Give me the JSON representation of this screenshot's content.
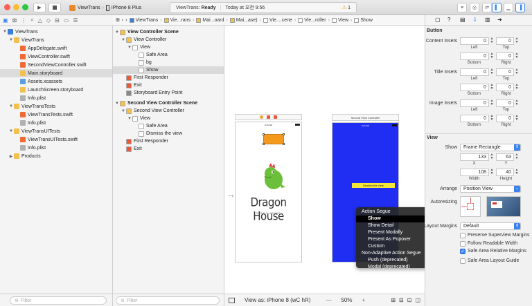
{
  "toolbar": {
    "scheme_app": "ViewTrans",
    "scheme_device": "iPhone 8 Plus",
    "status_app": "ViewTrans:",
    "status_state": "Ready",
    "status_time": "Today at 오전 9:56",
    "warning_count": "1"
  },
  "navigator": {
    "rows": [
      {
        "label": "ViewTrans",
        "indent": 0,
        "disc": "▼",
        "icon": "project-icon",
        "color": "#3b7fd9"
      },
      {
        "label": "ViewTrans",
        "indent": 1,
        "disc": "▼",
        "icon": "folder-icon",
        "color": "#f2c04e"
      },
      {
        "label": "AppDelegate.swift",
        "indent": 2,
        "disc": "",
        "icon": "swift-file-icon",
        "color": "#f06a35"
      },
      {
        "label": "ViewController.swift",
        "indent": 2,
        "disc": "",
        "icon": "swift-file-icon",
        "color": "#f06a35"
      },
      {
        "label": "SecondViewController.swift",
        "indent": 2,
        "disc": "",
        "icon": "swift-file-icon",
        "color": "#f06a35"
      },
      {
        "label": "Main.storyboard",
        "indent": 2,
        "disc": "",
        "icon": "storyboard-icon",
        "color": "#f2c04e",
        "selected": true
      },
      {
        "label": "Assets.xcassets",
        "indent": 2,
        "disc": "",
        "icon": "assets-icon",
        "color": "#5aa0e0"
      },
      {
        "label": "LaunchScreen.storyboard",
        "indent": 2,
        "disc": "",
        "icon": "storyboard-icon",
        "color": "#f2c04e"
      },
      {
        "label": "Info.plist",
        "indent": 2,
        "disc": "",
        "icon": "plist-icon",
        "color": "#b0b0b0"
      },
      {
        "label": "ViewTransTests",
        "indent": 1,
        "disc": "▼",
        "icon": "folder-icon",
        "color": "#f2c04e"
      },
      {
        "label": "ViewTransTests.swift",
        "indent": 2,
        "disc": "",
        "icon": "swift-file-icon",
        "color": "#f06a35"
      },
      {
        "label": "Info.plist",
        "indent": 2,
        "disc": "",
        "icon": "plist-icon",
        "color": "#b0b0b0"
      },
      {
        "label": "ViewTransUITests",
        "indent": 1,
        "disc": "▼",
        "icon": "folder-icon",
        "color": "#f2c04e"
      },
      {
        "label": "ViewTransUITests.swift",
        "indent": 2,
        "disc": "",
        "icon": "swift-file-icon",
        "color": "#f06a35"
      },
      {
        "label": "Info.plist",
        "indent": 2,
        "disc": "",
        "icon": "plist-icon",
        "color": "#b0b0b0"
      },
      {
        "label": "Products",
        "indent": 1,
        "disc": "▶",
        "icon": "folder-icon",
        "color": "#f2c04e"
      }
    ],
    "filter_placeholder": "Filter"
  },
  "jumpbar": [
    "ViewTrans",
    "Vie...rans",
    "Mai...oard",
    "Mai...ase)",
    "Vie....cene",
    "Vie...roller",
    "View",
    "Show"
  ],
  "outline": {
    "rows": [
      {
        "label": "View Controller Scene",
        "indent": 0,
        "disc": "▼",
        "icon": "scene-icon",
        "color": "#f2c04e",
        "bold": true
      },
      {
        "label": "View Controller",
        "indent": 1,
        "disc": "▼",
        "icon": "view-controller-icon",
        "color": "#f2c04e"
      },
      {
        "label": "View",
        "indent": 2,
        "disc": "▼",
        "icon": "view-icon",
        "color": "#ffffff"
      },
      {
        "label": "Safe Area",
        "indent": 3,
        "disc": "",
        "icon": "safe-area-icon",
        "color": "#ffffff"
      },
      {
        "label": "bg",
        "indent": 3,
        "disc": "",
        "icon": "image-view-icon",
        "color": "#ffffff"
      },
      {
        "label": "Show",
        "indent": 3,
        "disc": "",
        "icon": "button-icon",
        "color": "#ffffff",
        "selected": true
      },
      {
        "label": "First Responder",
        "indent": 1,
        "disc": "",
        "icon": "first-responder-icon",
        "color": "#e85a3c"
      },
      {
        "label": "Exit",
        "indent": 1,
        "disc": "",
        "icon": "exit-icon",
        "color": "#e85a3c"
      },
      {
        "label": "Storyboard Entry Point",
        "indent": 1,
        "disc": "",
        "icon": "entry-arrow-icon",
        "color": "#888888"
      },
      {
        "label": "Second View Controller Scene",
        "indent": 0,
        "disc": "▼",
        "icon": "scene-icon",
        "color": "#f2c04e",
        "bold": true,
        "gap": true
      },
      {
        "label": "Second View Controller",
        "indent": 1,
        "disc": "▼",
        "icon": "view-controller-icon",
        "color": "#f2c04e"
      },
      {
        "label": "View",
        "indent": 2,
        "disc": "▼",
        "icon": "view-icon",
        "color": "#ffffff"
      },
      {
        "label": "Safe Area",
        "indent": 3,
        "disc": "",
        "icon": "safe-area-icon",
        "color": "#ffffff"
      },
      {
        "label": "Dismiss the view",
        "indent": 3,
        "disc": "",
        "icon": "button-icon",
        "color": "#ffffff"
      },
      {
        "label": "First Responder",
        "indent": 1,
        "disc": "",
        "icon": "first-responder-icon",
        "color": "#e85a3c"
      },
      {
        "label": "Exit",
        "indent": 1,
        "disc": "",
        "icon": "exit-icon",
        "color": "#e85a3c"
      }
    ],
    "filter_placeholder": "Filter"
  },
  "canvas": {
    "scene1_time": "9:41 AM",
    "brand_title": "Dragon House",
    "brand_sub": "GUEST HOUSE",
    "scene2_title": "Second View Controller",
    "scene2_time": "9:41 AM",
    "dismiss_label": "Dismiss the view",
    "bottom_view_as": "View as: iPhone 8 (wC hR)",
    "zoom_minus": "—",
    "zoom": "50%",
    "zoom_plus": "+"
  },
  "segue_menu": {
    "header1": "Action Segue",
    "items1": [
      "Show",
      "Show Detail",
      "Present Modally",
      "Present As Popover",
      "Custom"
    ],
    "header2": "Non-Adaptive Action Segue",
    "items2": [
      "Push (deprecated)",
      "Modal (deprecated)"
    ],
    "selected": "Show"
  },
  "inspector": {
    "button_section": "Button",
    "content_insets": "Content Insets",
    "title_insets": "Title Insets",
    "image_insets": "Image Insets",
    "zero": "0",
    "left": "Left",
    "top": "Top",
    "bottom": "Bottom",
    "right": "Right",
    "view_section": "View",
    "show_label": "Show",
    "show_value": "Frame Rectangle",
    "x_value": "133",
    "y_value": "63",
    "x_label": "X",
    "y_label": "Y",
    "width_value": "108",
    "height_value": "40",
    "width_label": "Width",
    "height_label": "Height",
    "arrange_label": "Arrange",
    "arrange_value": "Position View",
    "autoresizing_label": "Autoresizing",
    "layout_margins_label": "Layout Margins",
    "layout_margins_value": "Default",
    "preserve_label": "Preserve Superview Margins",
    "follow_label": "Follow Readable Width",
    "safe_rel_label": "Safe Area Relative Margins",
    "safe_guide_label": "Safe Area Layout Guide"
  }
}
